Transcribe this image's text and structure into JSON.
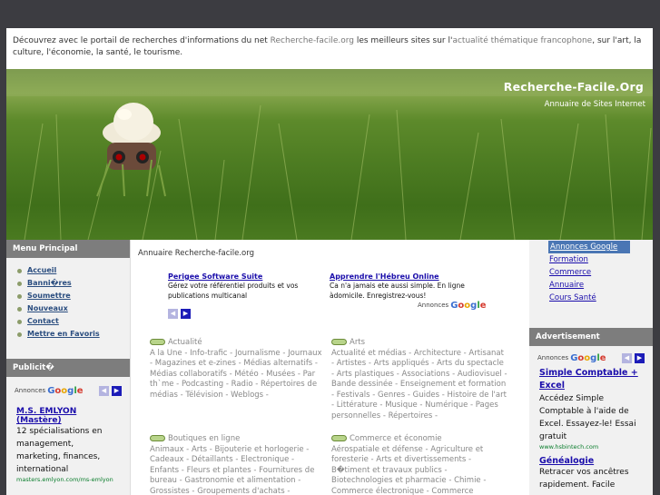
{
  "intro": {
    "part1": "Découvrez avec le portail de recherches d'informations du net ",
    "site": "Recherche-facile.org",
    "part2": " les meilleurs sites sur l'",
    "topic": "actualité thématique francophone",
    "part3": ", sur l'art, la culture, l'économie, la santé, le tourisme."
  },
  "header": {
    "title": "Recherche-Facile.Org",
    "subtitle": "Annuaire de Sites Internet"
  },
  "left": {
    "menu_title": "Menu Principal",
    "menu": [
      "Accueil",
      "Banni�res",
      "Soumettre",
      "Nouveaux",
      "Contact",
      "Mettre en Favoris"
    ],
    "pub_title": "Publicit�",
    "annonces": "Annonces",
    "ad": {
      "title": "M.S. EMLYON (Mastère)",
      "text": "12 spécialisations en management, marketing, finances, international",
      "url": "masters.emlyon.com/ms-emlyon"
    }
  },
  "center": {
    "breadcrumb": "Annuaire Recherche-facile.org",
    "ads": [
      {
        "title": "Perigee Software Suite",
        "text": "Gérez votre référentiel produits et vos publications multicanal"
      },
      {
        "title": "Apprendre l'Hébreu Online",
        "text": "Ca n'a jamais ete aussi simple. En ligne àdomicile. Enregistrez-vous!"
      }
    ],
    "annonces": "Annonces",
    "categories": [
      {
        "name": "Actualité",
        "items": "A la Une - Info-trafic - Journalisme - Journaux - Magazines et e-zines - Médias alternatifs - Médias collaboratifs - Météo - Musées - Par th`me - Podcasting - Radio - Répertoires de médias - Télévision - Weblogs -"
      },
      {
        "name": "Arts",
        "items": "Actualité et médias - Architecture - Artisanat - Artistes - Arts appliqués - Arts du spectacle - Arts plastiques - Associations - Audiovisuel - Bande dessinée - Enseignement et formation - Festivals - Genres - Guides - Histoire de l'art - Littérature - Musique - Numérique - Pages personnelles - Répertoires -"
      },
      {
        "name": "Boutiques en ligne",
        "items": "Animaux - Arts - Bijouterie et horlogerie - Cadeaux - Détaillants - Electronique - Enfants - Fleurs et plantes - Fournitures de bureau - Gastronomie et alimentation - Grossistes - Groupements d'achats - Habillement -"
      },
      {
        "name": "Commerce et économie",
        "items": "Aérospatiale et défense - Agriculture et foresterie - Arts et divertissements - B�timent et travaux publics - Biotechnologies et pharmacie - Chimie - Commerce électronique - Commerce international - Comptabilité - Economie et société -"
      }
    ]
  },
  "right": {
    "links": [
      "Annonces Google",
      "Formation",
      "Commerce",
      "Annuaire",
      "Cours Santé"
    ],
    "adv_title": "Advertisement",
    "annonces": "Annonces",
    "ads": [
      {
        "title": "Simple Comptable + Excel",
        "text": "Accédez Simple Comptable à l'aide de Excel. Essayez-le! Essai gratuit",
        "url": "www.hsbintech.com"
      },
      {
        "title": "Généalogie",
        "text": "Retracer vos ancêtres rapidement. Facile"
      }
    ]
  },
  "colors": {
    "background": "#3c3c41",
    "sidebar_head": "#7d7d7d",
    "link": "#1a0dab",
    "menu_link": "#2a4d7f",
    "active_link_bg": "#4a76b4"
  }
}
